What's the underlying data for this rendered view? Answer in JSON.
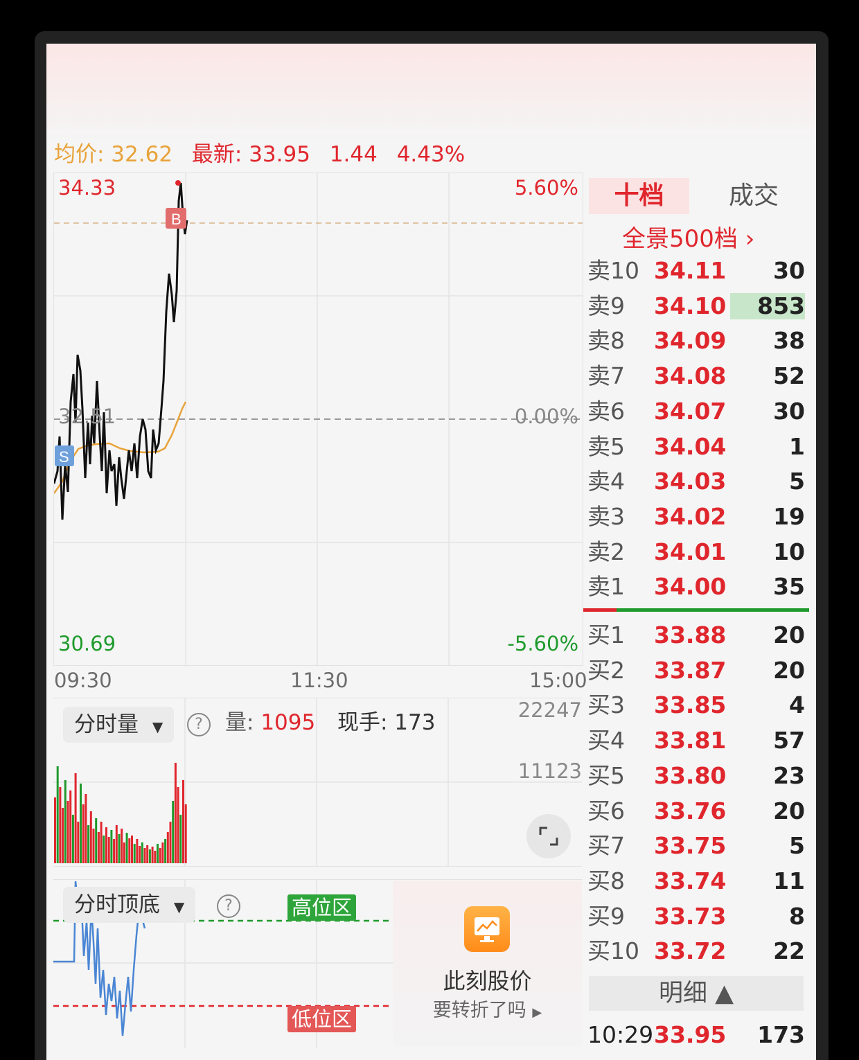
{
  "quote": {
    "avg_label": "均价: 32.62",
    "latest_label": "最新: 33.95",
    "change": "1.44",
    "change_pct": "4.43%"
  },
  "price_chart": {
    "high_price": "34.33",
    "high_pct": "5.60%",
    "ref_price": "32.51",
    "ref_pct": "0.00%",
    "low_price": "30.69",
    "low_pct": "-5.60%",
    "buy_marker": "B",
    "sell_marker": "S",
    "time_start": "09:30",
    "time_mid": "11:30",
    "time_end": "15:00"
  },
  "volume_panel": {
    "selector_label": "分时量",
    "help_icon": "?",
    "volume_label": "量: ",
    "volume_value": "1095",
    "hand_label": "现手: 173",
    "scale_top": "22247",
    "scale_mid": "11123"
  },
  "oscillator_panel": {
    "selector_label": "分时顶底",
    "help_icon": "?",
    "high_zone": "高位区",
    "low_zone": "低位区"
  },
  "promo": {
    "title": "此刻股价",
    "subtitle": "要转折了吗"
  },
  "order_book": {
    "tab_active": "十档",
    "tab_inactive": "成交",
    "panorama_link": "全景500档 ›",
    "asks": [
      {
        "label": "卖10",
        "price": "34.11",
        "qty": "30"
      },
      {
        "label": "卖9",
        "price": "34.10",
        "qty": "853"
      },
      {
        "label": "卖8",
        "price": "34.09",
        "qty": "38"
      },
      {
        "label": "卖7",
        "price": "34.08",
        "qty": "52"
      },
      {
        "label": "卖6",
        "price": "34.07",
        "qty": "30"
      },
      {
        "label": "卖5",
        "price": "34.04",
        "qty": "1"
      },
      {
        "label": "卖4",
        "price": "34.03",
        "qty": "5"
      },
      {
        "label": "卖3",
        "price": "34.02",
        "qty": "19"
      },
      {
        "label": "卖2",
        "price": "34.01",
        "qty": "10"
      },
      {
        "label": "卖1",
        "price": "34.00",
        "qty": "35"
      }
    ],
    "bids": [
      {
        "label": "买1",
        "price": "33.88",
        "qty": "20"
      },
      {
        "label": "买2",
        "price": "33.87",
        "qty": "20"
      },
      {
        "label": "买3",
        "price": "33.85",
        "qty": "4"
      },
      {
        "label": "买4",
        "price": "33.81",
        "qty": "57"
      },
      {
        "label": "买5",
        "price": "33.80",
        "qty": "23"
      },
      {
        "label": "买6",
        "price": "33.76",
        "qty": "20"
      },
      {
        "label": "买7",
        "price": "33.75",
        "qty": "5"
      },
      {
        "label": "买8",
        "price": "33.74",
        "qty": "11"
      },
      {
        "label": "买9",
        "price": "33.73",
        "qty": "8"
      },
      {
        "label": "买10",
        "price": "33.72",
        "qty": "22"
      }
    ],
    "detail_button": "明细 ▲",
    "last_trade": {
      "time": "10:29",
      "price": "33.95",
      "qty": "173"
    }
  },
  "colors": {
    "up": "#e0262d",
    "down": "#1f9a2c",
    "avg_line": "#e8a33a",
    "price_line": "#111111",
    "osc_line": "#4a86d4"
  }
}
